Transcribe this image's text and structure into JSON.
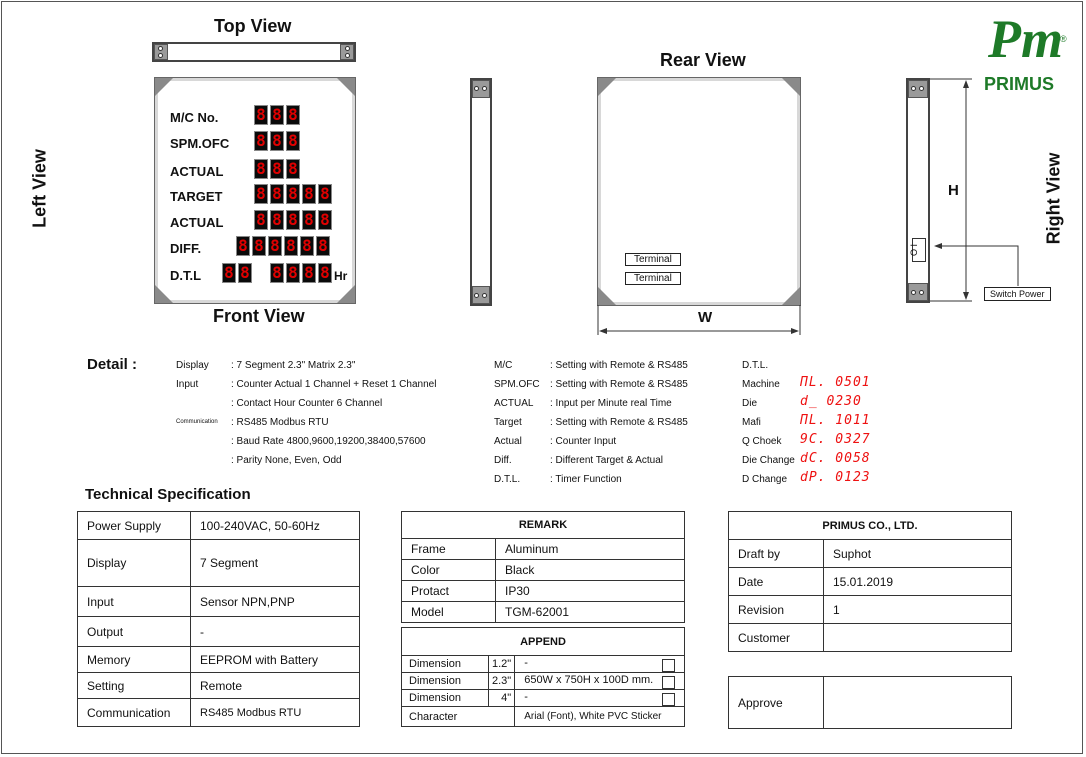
{
  "views": {
    "top": "Top View",
    "front": "Front View",
    "rear": "Rear View",
    "left": "Left View",
    "right": "Right View"
  },
  "logo": {
    "mark": "Pm",
    "registered": "®",
    "name": "PRIMUS",
    "color": "#1e7a28"
  },
  "front_panel": {
    "rows": [
      {
        "label": "M/C No.",
        "digits": [
          "8",
          "8",
          "8"
        ]
      },
      {
        "label": "SPM.OFC",
        "digits": [
          "8",
          "8",
          "8"
        ]
      },
      {
        "label": "ACTUAL",
        "digits": [
          "8",
          "8",
          "8"
        ]
      },
      {
        "label": "TARGET",
        "digits": [
          "8",
          "8",
          "8",
          "8",
          "8"
        ]
      },
      {
        "label": "ACTUAL",
        "digits": [
          "8",
          "8",
          "8",
          "8",
          "8"
        ]
      },
      {
        "label": "DIFF.",
        "digits": [
          "8",
          "8",
          "8",
          "8",
          "8",
          "8"
        ]
      },
      {
        "label": "D.T.L",
        "digits": [
          "8",
          "8"
        ],
        "digits2": [
          "8",
          "8",
          "8",
          "8"
        ],
        "unit": "Hr"
      }
    ],
    "digit_color": "#e00000"
  },
  "rear": {
    "terminal1": "Terminal",
    "terminal2": "Terminal",
    "width_label": "W"
  },
  "right": {
    "height_label": "H",
    "switch_label": "Switch Power",
    "switch_glyph": "O I"
  },
  "detail": {
    "title": "Detail :",
    "col1": [
      {
        "k": "Display",
        "v": ": 7 Segment 2.3\"  Matrix 2.3\""
      },
      {
        "k": "Input",
        "v": ": Counter Actual 1 Channel  + Reset 1 Channel"
      },
      {
        "k": "",
        "v": ": Contact Hour Counter 6 Channel"
      },
      {
        "k": "Communication",
        "v": ": RS485 Modbus RTU"
      },
      {
        "k": "",
        "v": ": Baud Rate 4800,9600,19200,38400,57600"
      },
      {
        "k": "",
        "v": ": Parity None, Even, Odd"
      }
    ],
    "col2": [
      {
        "k": "M/C",
        "v": ": Setting with Remote & RS485"
      },
      {
        "k": "SPM.OFC",
        "v": ": Setting with Remote & RS485"
      },
      {
        "k": "ACTUAL",
        "v": ": Input per Minute real Time"
      },
      {
        "k": "Target",
        "v": ": Setting with Remote & RS485"
      },
      {
        "k": "Actual",
        "v": ": Counter Input"
      },
      {
        "k": "Diff.",
        "v": ": Different Target & Actual"
      },
      {
        "k": "D.T.L.",
        "v": ": Timer Function"
      }
    ],
    "col3_title": "D.T.L.",
    "col3": [
      {
        "k": "Machine",
        "v": "ΠL. 0501"
      },
      {
        "k": "Die",
        "v": "d_ 0230"
      },
      {
        "k": "Mafi",
        "v": "ΠL. 1011"
      },
      {
        "k": "Q Choek",
        "v": "9C. 0327"
      },
      {
        "k": "Die Change",
        "v": "dC. 0058"
      },
      {
        "k": "D Change",
        "v": "dP. 0123"
      }
    ]
  },
  "tech": {
    "title": "Technical Specification",
    "rows": [
      {
        "k": "Power Supply",
        "v": "100-240VAC, 50-60Hz"
      },
      {
        "k": "Display",
        "v": "7 Segment"
      },
      {
        "k": "Input",
        "v": "Sensor NPN,PNP"
      },
      {
        "k": "Output",
        "v": "-"
      },
      {
        "k": "Memory",
        "v": "EEPROM with Battery"
      },
      {
        "k": "Setting",
        "v": "Remote"
      },
      {
        "k": "Communication",
        "v": "RS485 Modbus RTU"
      }
    ]
  },
  "remark": {
    "title": "REMARK",
    "rows": [
      {
        "k": "Frame",
        "v": "Aluminum"
      },
      {
        "k": "Color",
        "v": "Black"
      },
      {
        "k": "Protact",
        "v": "IP30"
      },
      {
        "k": "Model",
        "v": "TGM-62001"
      }
    ]
  },
  "append": {
    "title": "APPEND",
    "rows": [
      {
        "k": "Dimension",
        "size": "1.2\"",
        "v": "-"
      },
      {
        "k": "Dimension",
        "size": "2.3\"",
        "v": "650W x 750H x 100D mm."
      },
      {
        "k": "Dimension",
        "size": "4\"",
        "v": "-"
      }
    ],
    "character_label": "Character",
    "character_value": "Arial (Font), White PVC Sticker"
  },
  "company": {
    "title": "PRIMUS CO., LTD.",
    "rows": [
      {
        "k": "Draft by",
        "v": "Suphot"
      },
      {
        "k": "Date",
        "v": "15.01.2019"
      },
      {
        "k": "Revision",
        "v": "1"
      },
      {
        "k": "Customer",
        "v": ""
      }
    ],
    "approve": "Approve"
  }
}
